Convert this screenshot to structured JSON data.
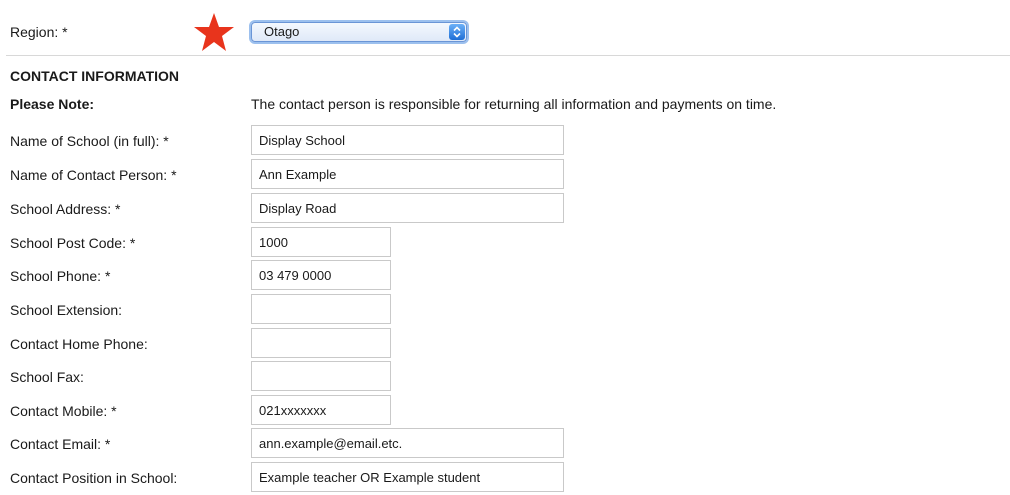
{
  "region": {
    "label": "Region: *",
    "selected": "Otago",
    "marker_color": "#e8341c",
    "select_icon": "chevron-updown-icon"
  },
  "contact": {
    "section_title": "CONTACT INFORMATION",
    "note_label": "Please Note:",
    "note_text": "The contact person is responsible for returning all information and payments on time."
  },
  "fields": [
    {
      "label": "Name of School (in full): *",
      "value": ""
    },
    {
      "label": "Name of Contact Person: *",
      "value": ""
    },
    {
      "label": "School Address: *",
      "value": ""
    },
    {
      "label": "School Post Code: *",
      "value": ""
    },
    {
      "label": "School Phone: *",
      "value": ""
    },
    {
      "label": "School Extension:",
      "value": ""
    },
    {
      "label": "Contact Home Phone:",
      "value": ""
    },
    {
      "label": "School Fax:",
      "value": ""
    },
    {
      "label": "Contact Mobile: *",
      "value": ""
    },
    {
      "label": "Contact Email: *",
      "value": ""
    },
    {
      "label": "Contact Position in School:",
      "value": ""
    }
  ],
  "values": {
    "school_name": "Display School",
    "contact_person": "Ann Example",
    "school_address": "Display Road",
    "post_code": "1000",
    "school_phone": "03 479 0000",
    "school_extension": "",
    "home_phone": "",
    "school_fax": "",
    "mobile": "021xxxxxxx",
    "email": "ann.example@email.etc.",
    "position": "Example teacher OR Example student"
  }
}
